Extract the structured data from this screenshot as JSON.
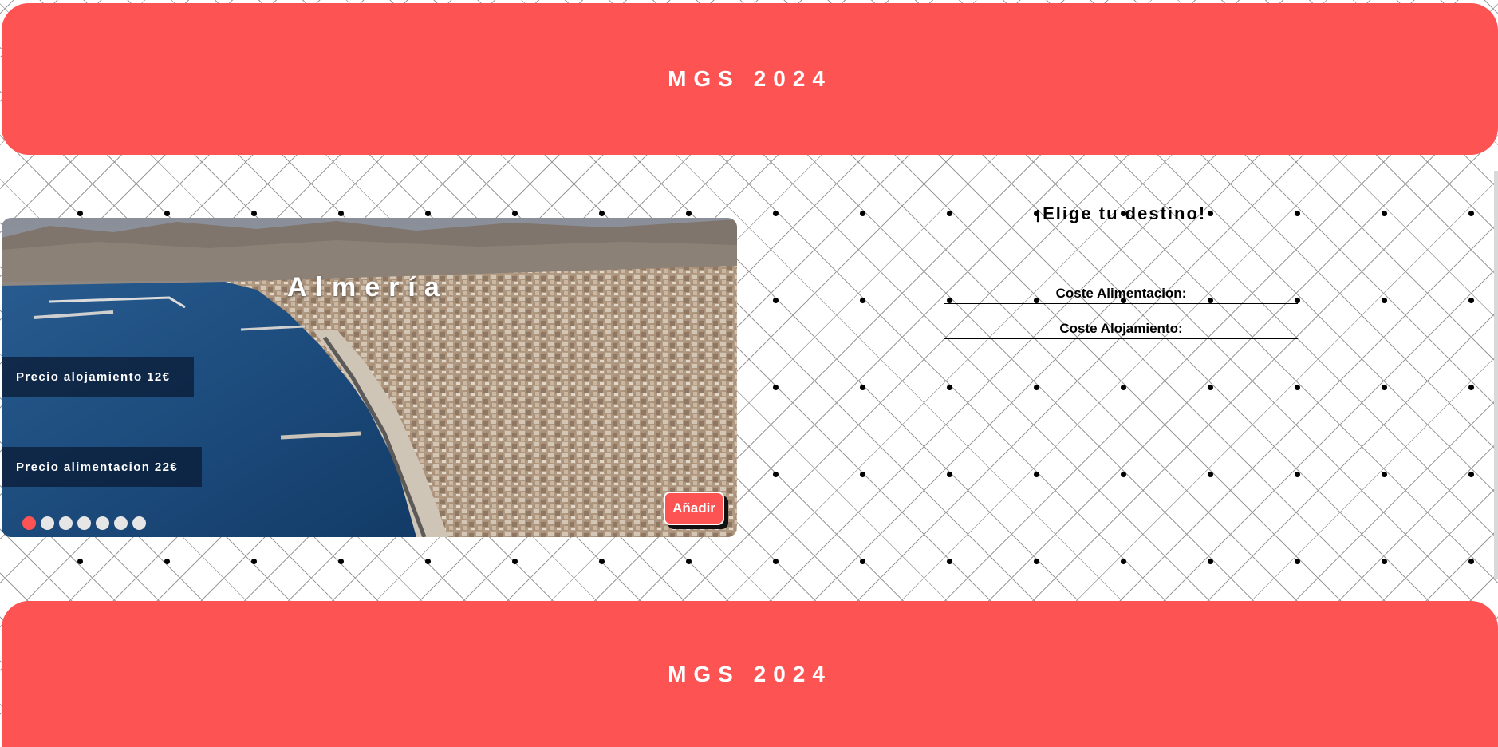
{
  "header": {
    "title": "MGS 2024"
  },
  "footer": {
    "title": "MGS 2024"
  },
  "carousel": {
    "city": "Almería",
    "accommodation_price": "Precio alojamiento 12€",
    "food_price": "Precio alimentacion 22€",
    "add_label": "Añadir",
    "slide_count": 7,
    "active_slide": 1
  },
  "panel": {
    "title": "¡Elige tu destino!",
    "food_cost_label": "Coste Alimentacion:",
    "lodging_cost_label": "Coste Alojamiento:"
  },
  "colors": {
    "accent": "#fd5353",
    "overlay": "#0a1932",
    "text_light": "#ffffff",
    "dot_inactive": "#e6e6e6"
  }
}
